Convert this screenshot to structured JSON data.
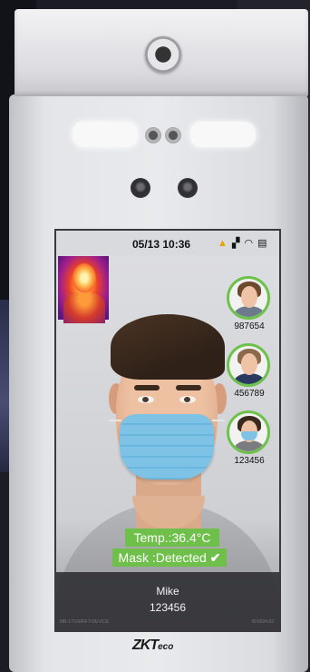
{
  "status_bar": {
    "time": "05/13 10:36",
    "icons": [
      "warning-icon",
      "network-icon",
      "wifi-icon",
      "storage-icon"
    ]
  },
  "gallery": [
    {
      "id": "987654",
      "hair": "#6b4a2e",
      "body": "#6b7a8c",
      "masked": false
    },
    {
      "id": "456789",
      "hair": "#8a6a4a",
      "body": "#2a3a5e",
      "masked": false
    },
    {
      "id": "123456",
      "hair": "#3a2a1e",
      "body": "#7a7c80",
      "masked": true
    }
  ],
  "result": {
    "temperature": "Temp.:36.4°C",
    "mask": "Mask :Detected",
    "check": "✔",
    "name": "Mike",
    "id": "123456"
  },
  "footer": {
    "left": "MB-17/VERIFY/DEVICE",
    "right": "ID/0034.83"
  },
  "brand": {
    "main": "ZKT",
    "sub": "eco"
  },
  "colors": {
    "accent": "#6ec04a",
    "ring": "#6cc24a"
  }
}
